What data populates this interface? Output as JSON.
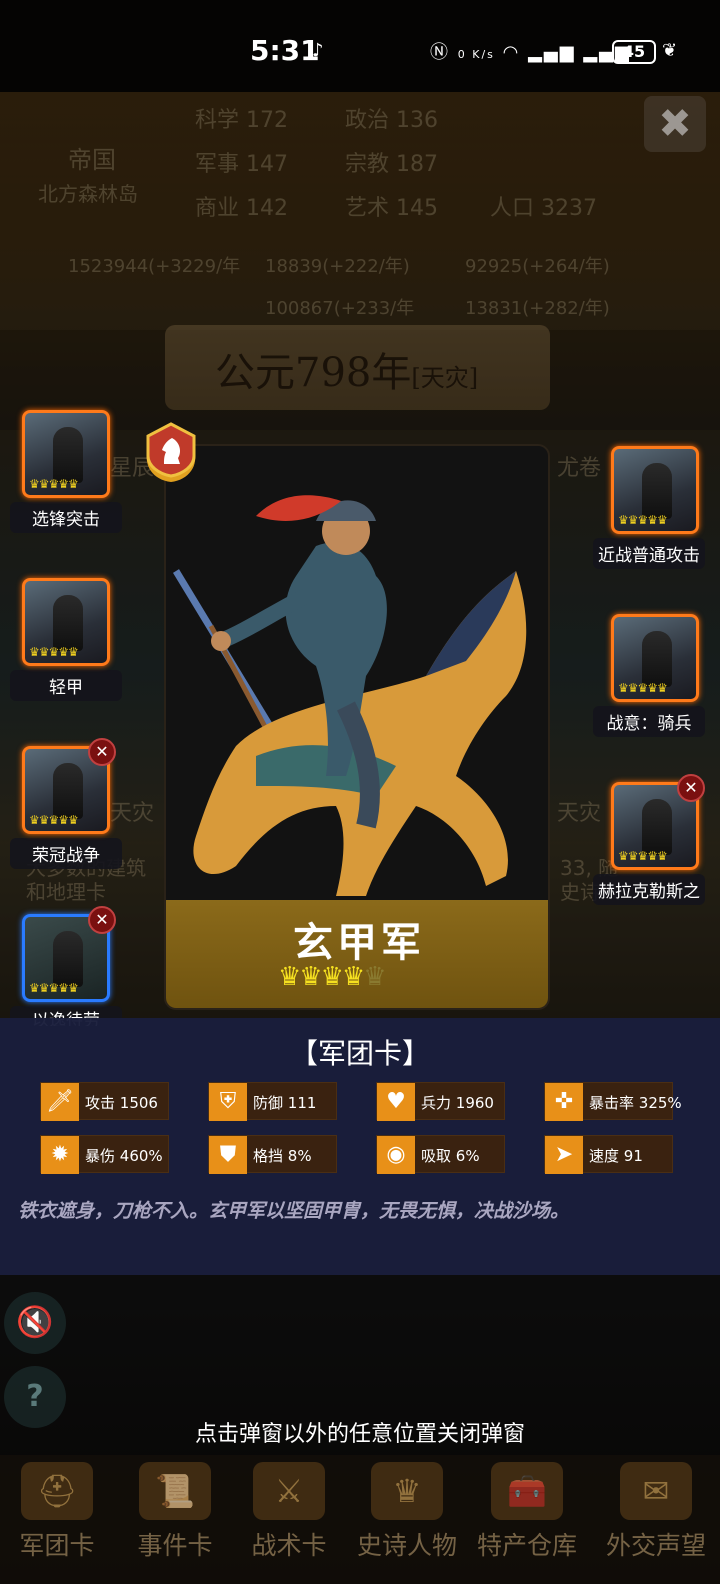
{
  "status_bar": {
    "time": "5:31",
    "network_speed": "0 K/s",
    "battery": "45",
    "icons": [
      "nfc-icon",
      "wifi-icon",
      "signal-icon",
      "signal-icon",
      "leaf-icon"
    ]
  },
  "background": {
    "emblem_title": "帝国",
    "location": "北方森林岛",
    "stats": [
      {
        "label": "科学",
        "value": "172"
      },
      {
        "label": "政治",
        "value": "136"
      },
      {
        "label": "军事",
        "value": "147"
      },
      {
        "label": "宗教",
        "value": "187"
      },
      {
        "label": "商业",
        "value": "142"
      },
      {
        "label": "艺术",
        "value": "145"
      },
      {
        "label": "人口",
        "value": "3237"
      }
    ],
    "resources": [
      "1523944(+3229/年",
      "18839(+222/年)",
      "92925(+264/年)",
      "100867(+233/年",
      "13831(+282/年)"
    ],
    "era": "公元798年",
    "era_tag": "[天灾]",
    "partial_texts": [
      "星辰",
      "尤卷",
      "天灾",
      "天灾",
      "大多数的建筑",
      "和地理卡",
      "33, 随",
      "史诗人"
    ]
  },
  "main_card": {
    "name": "玄甲军",
    "stars_filled": 4,
    "stars_total": 5
  },
  "left_cards": [
    {
      "label": "选锋突击",
      "closable": false,
      "border": "orange"
    },
    {
      "label": "轻甲",
      "closable": false,
      "border": "orange"
    },
    {
      "label": "荣冠战争",
      "closable": true,
      "border": "orange"
    },
    {
      "label": "以逸待劳",
      "closable": true,
      "border": "blue"
    }
  ],
  "right_cards": [
    {
      "label": "近战普通攻击",
      "closable": false
    },
    {
      "label": "战意：骑兵",
      "closable": false
    },
    {
      "label": "赫拉克勒斯之",
      "closable": true
    }
  ],
  "info_panel": {
    "type_label": "【军团卡】",
    "stats": [
      {
        "label": "攻击",
        "value": "1506",
        "icon": "sword-icon"
      },
      {
        "label": "防御",
        "value": "111",
        "icon": "shield-icon"
      },
      {
        "label": "兵力",
        "value": "1960",
        "icon": "heart-icon"
      },
      {
        "label": "暴击率",
        "value": "325%",
        "icon": "crit-icon"
      },
      {
        "label": "暴伤",
        "value": "460%",
        "icon": "burst-icon"
      },
      {
        "label": "格挡",
        "value": "8%",
        "icon": "block-icon"
      },
      {
        "label": "吸取",
        "value": "6%",
        "icon": "drain-icon"
      },
      {
        "label": "速度",
        "value": "91",
        "icon": "boot-icon"
      }
    ],
    "description": "铁衣遮身，刀枪不入。玄甲军以坚固甲胄，无畏无惧，决战沙场。"
  },
  "close_hint": "点击弹窗以外的任意位置关闭弹窗",
  "bottom_nav": [
    "军团卡",
    "事件卡",
    "战术卡",
    "史诗人物",
    "特产仓库",
    "外交声望"
  ]
}
